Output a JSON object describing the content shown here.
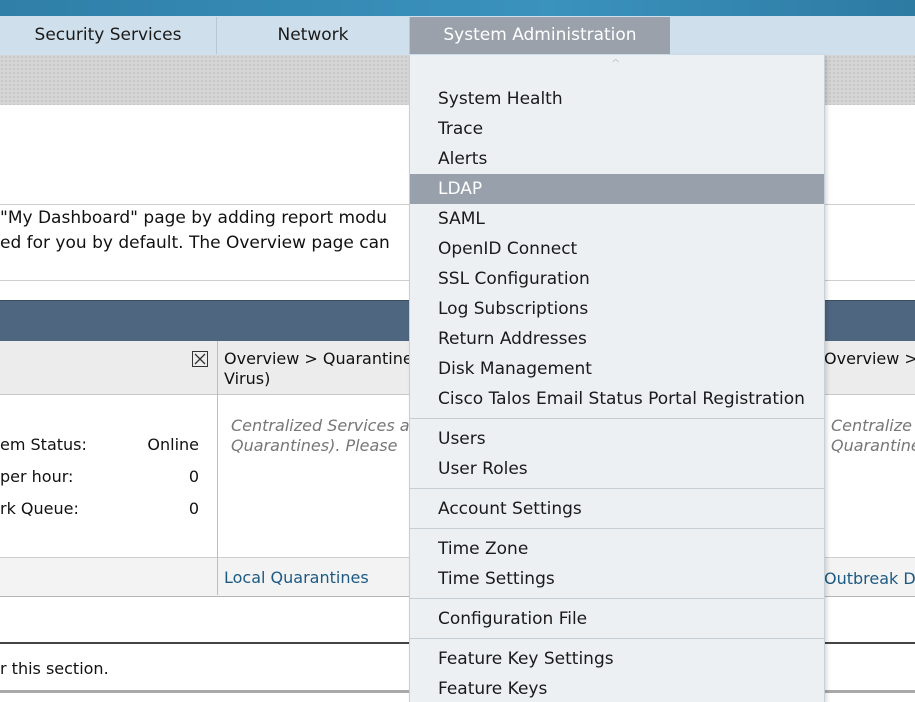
{
  "nav": {
    "tabs": [
      {
        "label": "Security Services"
      },
      {
        "label": "Network"
      },
      {
        "label": "System Administration"
      }
    ]
  },
  "intro": {
    "line1": "\"My Dashboard\" page by adding report modu",
    "line2": "ed for you by default. The Overview page can"
  },
  "columns": {
    "col2_head_line1": "Overview > Quarantine",
    "col2_head_line2": "Virus)",
    "col3_head": "Overview >"
  },
  "status": {
    "rows": [
      {
        "label": "em Status:",
        "value": "Online"
      },
      {
        "label": " per hour:",
        "value": "0"
      },
      {
        "label": "rk Queue:",
        "value": "0"
      }
    ]
  },
  "col2_text": {
    "line1": "Centralized Services a",
    "line2": "Quarantines). Please"
  },
  "col3_text": {
    "line1": "Centralize",
    "line2": "Quarantine"
  },
  "footer_links": {
    "local_quarantines": "Local Quarantines",
    "outbreak": "Outbreak D"
  },
  "section_text": "r this section.",
  "menu": {
    "caret": "^",
    "groups": [
      {
        "items": [
          {
            "label": "System Health"
          },
          {
            "label": "Trace"
          },
          {
            "label": "Alerts"
          },
          {
            "label": "LDAP",
            "highlighted": true
          },
          {
            "label": "SAML"
          },
          {
            "label": "OpenID Connect"
          },
          {
            "label": "SSL Configuration"
          },
          {
            "label": "Log Subscriptions"
          },
          {
            "label": "Return Addresses"
          },
          {
            "label": "Disk Management"
          },
          {
            "label": "Cisco Talos Email Status Portal Registration"
          }
        ]
      },
      {
        "items": [
          {
            "label": "Users"
          },
          {
            "label": "User Roles"
          }
        ]
      },
      {
        "items": [
          {
            "label": "Account Settings"
          }
        ]
      },
      {
        "items": [
          {
            "label": "Time Zone"
          },
          {
            "label": "Time Settings"
          }
        ]
      },
      {
        "items": [
          {
            "label": "Configuration File"
          }
        ]
      },
      {
        "items": [
          {
            "label": "Feature Key Settings"
          },
          {
            "label": "Feature Keys"
          }
        ]
      }
    ]
  },
  "colors": {
    "nav_active": "#9aa1ab",
    "menu_highlight": "#98a1ab",
    "panel_header": "#4f6680",
    "link": "#1c5a84"
  }
}
